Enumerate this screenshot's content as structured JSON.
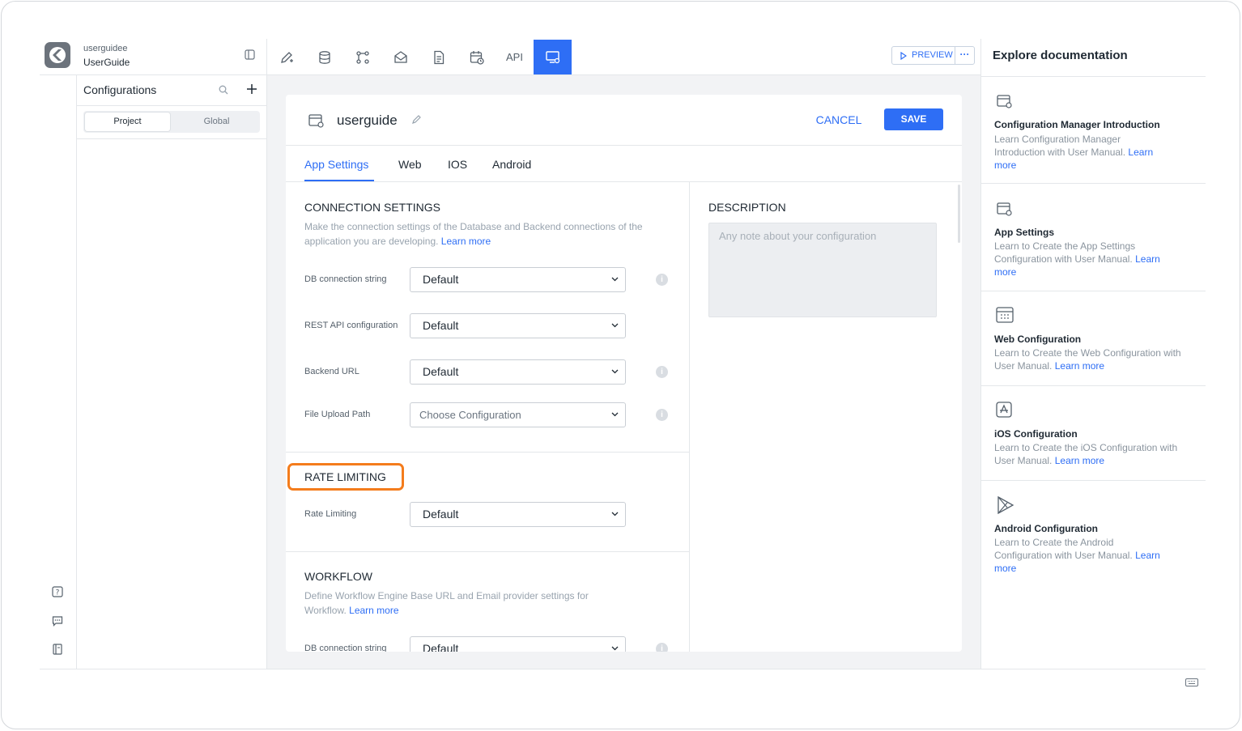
{
  "project": {
    "name": "userguidee",
    "display": "UserGuide"
  },
  "configurations": {
    "title": "Configurations",
    "segments": [
      "Project",
      "Global"
    ]
  },
  "toolbar": {
    "api_label": "API",
    "preview_label": "PREVIEW",
    "more_label": "···"
  },
  "editor": {
    "title": "userguide",
    "cancel": "CANCEL",
    "save": "SAVE",
    "tabs": [
      "App Settings",
      "Web",
      "IOS",
      "Android"
    ],
    "connection": {
      "title": "CONNECTION SETTINGS",
      "desc": "Make the connection settings of the Database and Backend connections of the application you are developing.",
      "link": "Learn more",
      "fields": [
        {
          "label": "DB connection string",
          "value": "Default"
        },
        {
          "label": "REST API configuration",
          "value": "Default"
        },
        {
          "label": "Backend URL",
          "value": "Default"
        },
        {
          "label": "File Upload Path",
          "value": "Choose Configuration"
        }
      ]
    },
    "rate": {
      "title": "RATE LIMITING",
      "field_label": "Rate Limiting",
      "value": "Default"
    },
    "workflow": {
      "title": "WORKFLOW",
      "desc": "Define Workflow Engine Base URL and Email provider settings for Workflow.",
      "link": "Learn more",
      "field_label": "DB connection string",
      "value": "Default"
    },
    "description": {
      "title": "DESCRIPTION",
      "placeholder": "Any note about your configuration"
    },
    "info_glyph": "i"
  },
  "docs": {
    "header": "Explore documentation",
    "items": [
      {
        "title": "Configuration Manager Introduction",
        "text": "Learn Configuration Manager Introduction with User Manual.",
        "link": "Learn more"
      },
      {
        "title": "App Settings",
        "text": "Learn to Create the App Settings Configuration with User Manual.",
        "link": "Learn more"
      },
      {
        "title": "Web Configuration",
        "text": "Learn to Create the Web Configuration with User Manual.",
        "link": "Learn more"
      },
      {
        "title": "iOS Configuration",
        "text": "Learn to Create the iOS Configuration with User Manual.",
        "link": "Learn more"
      },
      {
        "title": "Android Configuration",
        "text": "Learn to Create the Android Configuration with User Manual.",
        "link": "Learn more"
      }
    ]
  },
  "colors": {
    "accent": "#2e6ef5",
    "highlight": "#f47c1c"
  }
}
